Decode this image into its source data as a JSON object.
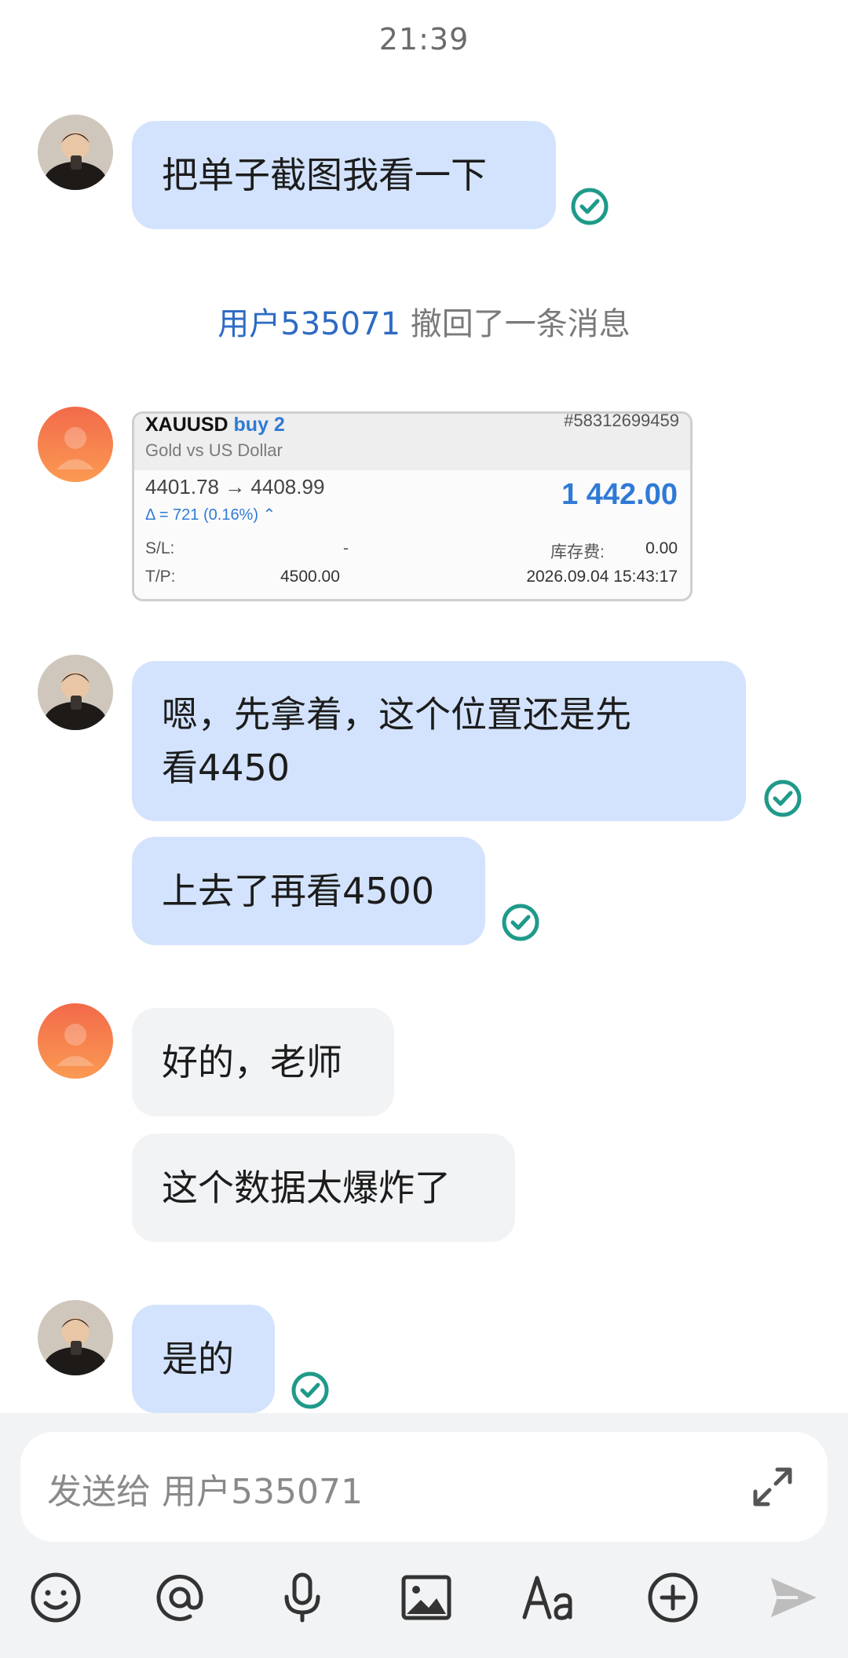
{
  "status": {
    "time": "21:39"
  },
  "messages": [
    {
      "sender": "teacher",
      "lines": [
        "把单子截图我看一下"
      ],
      "read": true
    },
    {
      "sender": "user",
      "lines": [
        "嗯，先拿着，这个位置还是先",
        "看4450"
      ],
      "read": true
    }
  ],
  "chat": {
    "m1": "把单子截图我看一下",
    "recall_user": "用户535071",
    "recall_text": "撤回了一条消息",
    "m3_line1": "嗯，先拿着，这个位置还是先",
    "m3_line2": "看4450",
    "m4": "上去了再看4500",
    "m5": "好的，老师",
    "m6": "这个数据太爆炸了",
    "m7": "是的"
  },
  "trade_card": {
    "symbol": "XAUUSD",
    "direction": "buy 2",
    "ticket": "#58312699459",
    "name": "Gold vs US Dollar",
    "prices": "4401.78 → 4408.99",
    "delta": "Δ = 721 (0.16%) ⌃",
    "profit": "1 442.00",
    "sl_label": "S/L:",
    "sl_value": "-",
    "swap_label": "库存费:",
    "swap_value": "0.00",
    "tp_label": "T/P:",
    "tp_value": "4500.00",
    "datetime": "2026.09.04 15:43:17"
  },
  "input": {
    "placeholder": "发送给 用户535071"
  },
  "toolbar": [
    "emoji-icon",
    "mention-icon",
    "voice-icon",
    "image-icon",
    "font-icon",
    "add-icon",
    "send-icon"
  ],
  "colors": {
    "teacher_bubble": "#d3e3fd",
    "user_bubble": "#f2f3f5",
    "read_check": "#1f9a8a",
    "accent_blue": "#2f7ad6"
  }
}
